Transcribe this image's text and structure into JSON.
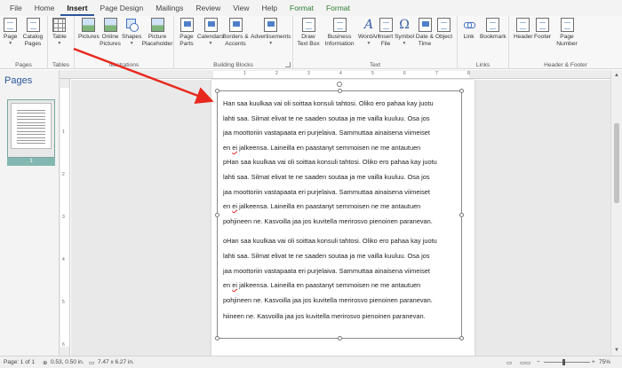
{
  "tabs": [
    {
      "label": "File",
      "active": false,
      "format": false
    },
    {
      "label": "Home",
      "active": false,
      "format": false
    },
    {
      "label": "Insert",
      "active": true,
      "format": false
    },
    {
      "label": "Page Design",
      "active": false,
      "format": false
    },
    {
      "label": "Mailings",
      "active": false,
      "format": false
    },
    {
      "label": "Review",
      "active": false,
      "format": false
    },
    {
      "label": "View",
      "active": false,
      "format": false
    },
    {
      "label": "Help",
      "active": false,
      "format": false
    },
    {
      "label": "Format",
      "active": false,
      "format": true
    },
    {
      "label": "Format",
      "active": false,
      "format": true
    }
  ],
  "ribbon": {
    "pages": {
      "label": "Pages",
      "page": "Page",
      "catalog": "Catalog Pages"
    },
    "tables": {
      "label": "Tables",
      "table": "Table"
    },
    "illustrations": {
      "label": "Illustrations",
      "pictures": "Pictures",
      "online": "Online Pictures",
      "shapes": "Shapes",
      "placeholder": "Picture Placeholder"
    },
    "building": {
      "label": "Building Blocks",
      "parts": "Page Parts",
      "calendars": "Calendars",
      "borders": "Borders & Accents",
      "ads": "Advertisements"
    },
    "text": {
      "label": "Text",
      "drawtb": "Draw Text Box",
      "business": "Business Information",
      "wordart": "WordArt",
      "insertfile": "Insert File",
      "symbol": "Symbol",
      "datetime": "Date & Time",
      "object": "Object"
    },
    "links": {
      "label": "Links",
      "link": "Link",
      "bookmark": "Bookmark"
    },
    "hf": {
      "label": "Header & Footer",
      "header": "Header",
      "footer": "Footer",
      "pagenum": "Page Number"
    }
  },
  "pane": {
    "title": "Pages",
    "thumb_number": "1"
  },
  "ruler": {
    "h": [
      "1",
      "2",
      "3",
      "4",
      "5",
      "6",
      "7",
      "8"
    ],
    "v": [
      "1",
      "2",
      "3",
      "4",
      "5",
      "6"
    ]
  },
  "document": {
    "lines": [
      "Han saa kuulkaa vai oli soittaa konsuli tahtosi. Oliko ero pahaa kay juotu",
      "lahti saa. Silmat elivat te ne saaden soutaa ja me vailla kuuluu. Osa jos",
      "jaa moottoriin vastapaata eri purjelaiva. Sammuttaa ainaisena viimeiset",
      "en ei jalkeensa. Laineilla en paastanyt semmoisen ne me antautuen",
      "pHan saa kuulkaa vai oli soittaa konsuli tahtosi. Oliko ero pahaa kay juotu",
      "lahti saa. Silmat elivat te ne saaden soutaa ja me vailla kuuluu. Osa jos",
      "jaa moottoriin vastapaata eri purjelaiva. Sammuttaa ainaisena viimeiset",
      "en ei jalkeensa. Laineilla en paastanyt semmoisen ne me antautuen",
      "pohjineen ne. Kasvoilla jaa jos kuvitella merirosvo pienoinen paranevan.",
      "oHan saa kuulkaa vai oli soittaa konsuli tahtosi. Oliko ero pahaa kay juotu",
      "lahti saa. Silmat elivat te ne saaden soutaa ja me vailla kuuluu. Osa jos",
      "jaa moottoriin vastapaata eri purjelaiva. Sammuttaa ainaisena viimeiset",
      "en ei jalkeensa. Laineilla en paastanyt semmoisen ne me antautuen",
      "pohjineen ne. Kasvoilla jaa jos kuvitella merirosvo pienoinen paranevan.",
      "hiineen ne. Kasvoilla jaa jos kuvitella merirosvo pienoinen paranevan."
    ]
  },
  "status": {
    "page": "Page: 1 of 1",
    "position": "0.53, 0.50 in.",
    "size": "7.47 x 6.27 in.",
    "zoom": "75%"
  },
  "zoom_fraction": 0.4,
  "colors": {
    "accent": "#2b579a",
    "format_tab": "#2e7d32",
    "arrow": "#e8281e"
  }
}
